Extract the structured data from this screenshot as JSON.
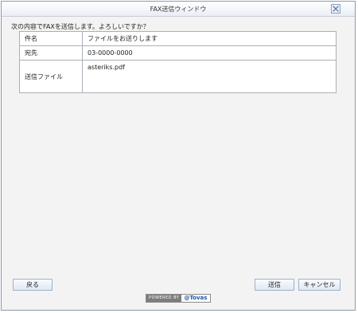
{
  "window": {
    "title": "FAX送信ウィンドウ",
    "close_label": "×"
  },
  "message": "次の内容でFAXを送信します。よろしいですか？",
  "details": {
    "rows": [
      {
        "label": "件名",
        "value": "ファイルをお送りします"
      },
      {
        "label": "宛先",
        "value": "03-0000-0000"
      },
      {
        "label": "送信ファイル",
        "value": "asteriks.pdf"
      }
    ]
  },
  "buttons": {
    "back": "戻る",
    "send": "送信",
    "cancel": "キャンセル"
  },
  "powered_by": {
    "prefix": "POWERED BY",
    "brand": "@Tovas"
  },
  "colors": {
    "window_background": "#f3f3f3",
    "table_background": "#ffffff",
    "border": "#aab0b8",
    "button_border": "#9fb1c8",
    "brand_blue": "#1d56a8"
  },
  "icons": {
    "close": "close-icon"
  }
}
